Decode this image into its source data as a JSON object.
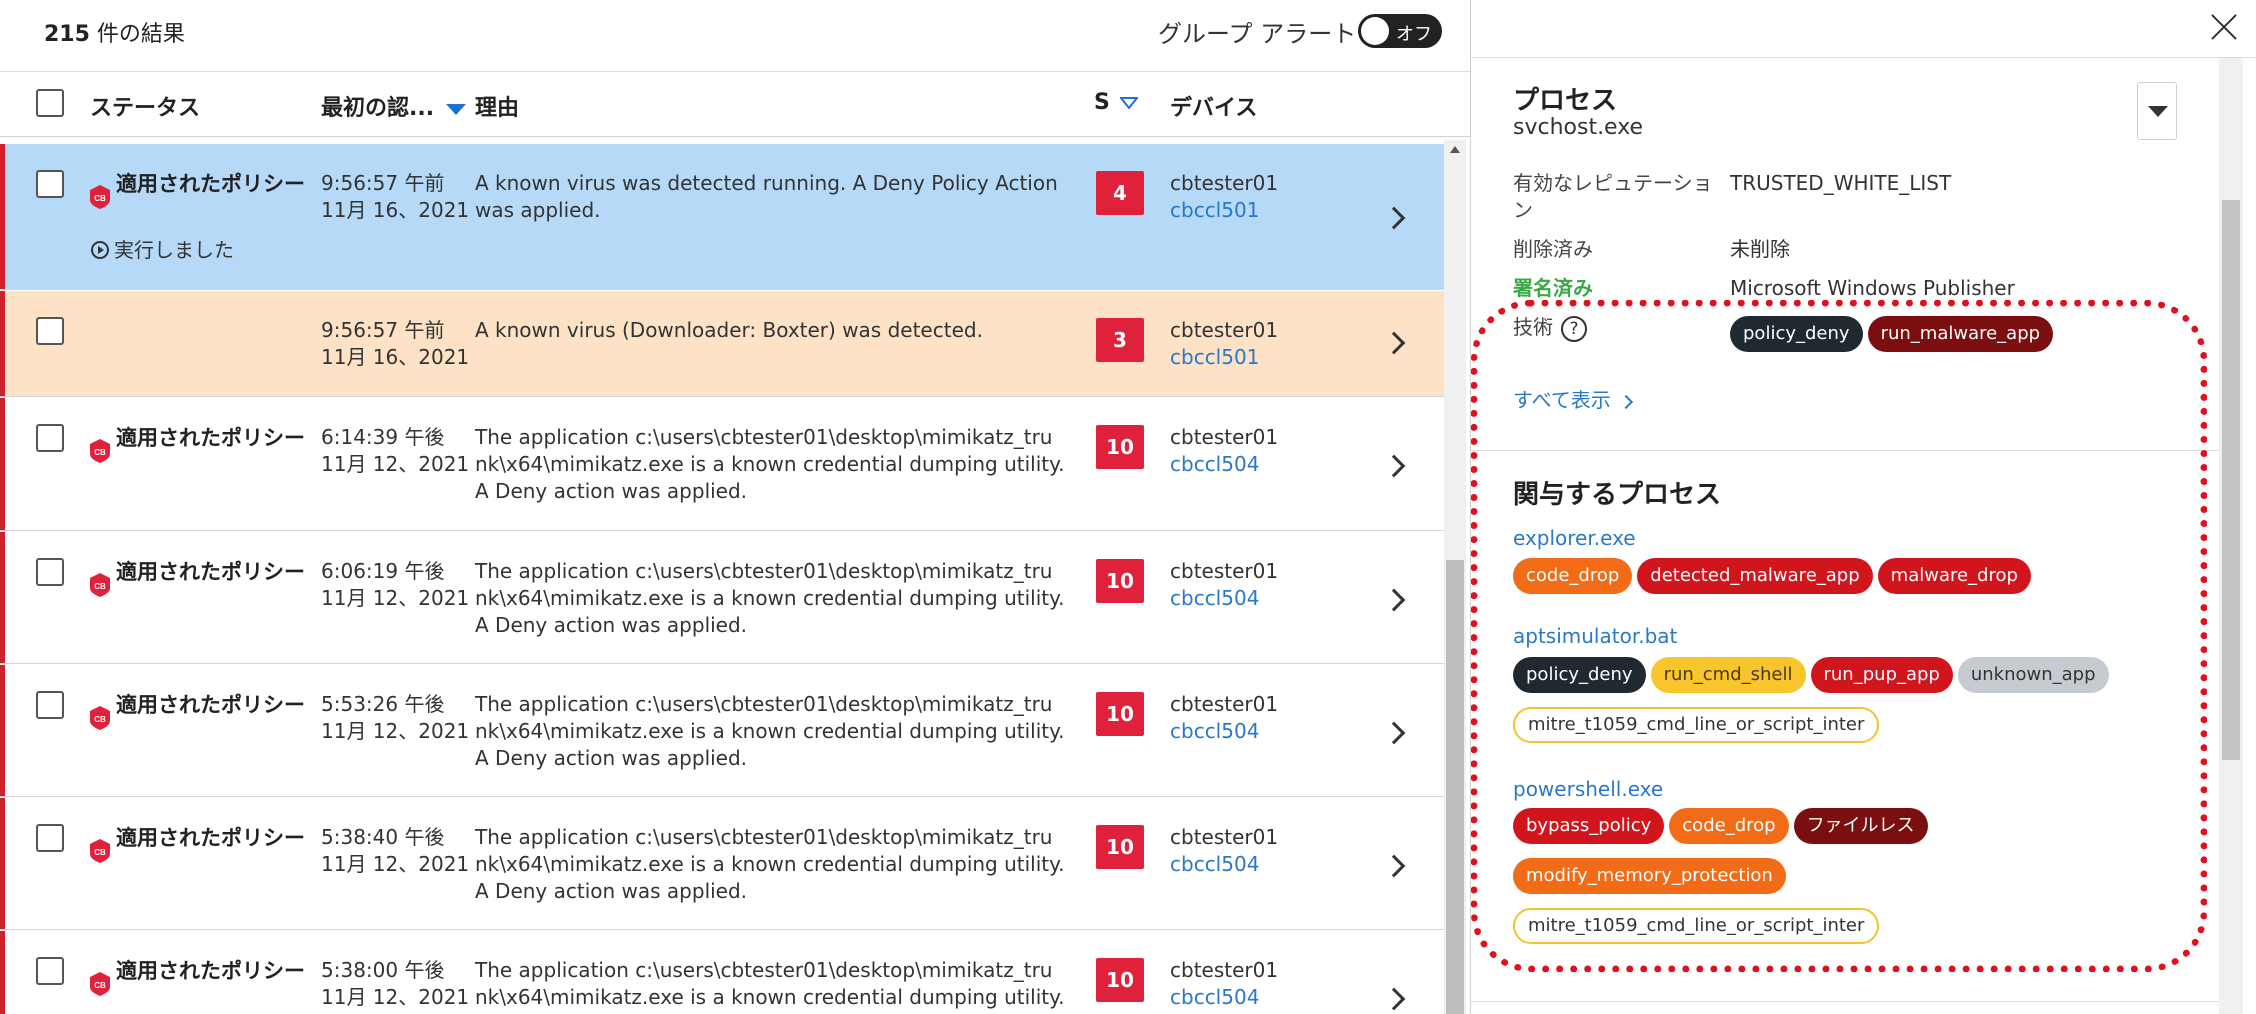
{
  "header": {
    "results_count": "215",
    "results_suffix": " 件の結果",
    "group_alert_label": "グループ アラート",
    "toggle_label": "オフ"
  },
  "table": {
    "columns": {
      "status": "ステータス",
      "first_seen": "最初の認...",
      "reason": "理由",
      "severity": "S",
      "device": "デバイス"
    },
    "rows": [
      {
        "status": "適用されたポリシー",
        "executed": "実行しました",
        "time": "9:56:57 午前",
        "date": "11月 16、2021",
        "reason": "A known virus was detected running. A Deny Policy Action was applied.",
        "severity": "4",
        "device": "cbtester01",
        "device_link": "cbccl501"
      },
      {
        "status": "",
        "executed": "",
        "time": "9:56:57 午前",
        "date": "11月 16、2021",
        "reason": "A known virus (Downloader: Boxter) was detected.",
        "severity": "3",
        "device": "cbtester01",
        "device_link": "cbccl501"
      },
      {
        "status": "適用されたポリシー",
        "executed": "",
        "time": "6:14:39 午後",
        "date": "11月 12、2021",
        "reason": "The application c:\\users\\cbtester01\\desktop\\mimikatz_trunk\\x64\\mimikatz.exe is a known credential dumping utility. A Deny action was applied.",
        "severity": "10",
        "device": "cbtester01",
        "device_link": "cbccl504"
      },
      {
        "status": "適用されたポリシー",
        "executed": "",
        "time": "6:06:19 午後",
        "date": "11月 12、2021",
        "reason": "The application c:\\users\\cbtester01\\desktop\\mimikatz_trunk\\x64\\mimikatz.exe is a known credential dumping utility. A Deny action was applied.",
        "severity": "10",
        "device": "cbtester01",
        "device_link": "cbccl504"
      },
      {
        "status": "適用されたポリシー",
        "executed": "",
        "time": "5:53:26 午後",
        "date": "11月 12、2021",
        "reason": "The application c:\\users\\cbtester01\\desktop\\mimikatz_trunk\\x64\\mimikatz.exe is a known credential dumping utility. A Deny action was applied.",
        "severity": "10",
        "device": "cbtester01",
        "device_link": "cbccl504"
      },
      {
        "status": "適用されたポリシー",
        "executed": "",
        "time": "5:38:40 午後",
        "date": "11月 12、2021",
        "reason": "The application c:\\users\\cbtester01\\desktop\\mimikatz_trunk\\x64\\mimikatz.exe is a known credential dumping utility. A Deny action was applied.",
        "severity": "10",
        "device": "cbtester01",
        "device_link": "cbccl504"
      },
      {
        "status": "適用されたポリシー",
        "executed": "",
        "time": "5:38:00 午後",
        "date": "11月 12、2021",
        "reason": "The application c:\\users\\cbtester01\\desktop\\mimikatz_trunk\\x64\\mimikatz.exe is a known credential dumping utility. A Te",
        "severity": "10",
        "device": "cbtester01",
        "device_link": "cbccl504"
      }
    ]
  },
  "panel": {
    "process_title": "プロセス",
    "process_name": "svchost.exe",
    "reputation_key": "有効なレピュテーション",
    "reputation_value": "TRUSTED_WHITE_LIST",
    "deleted_key": "削除済み",
    "deleted_value": "未削除",
    "signed_key": "署名済み",
    "signed_value": "Microsoft Windows Publisher",
    "tech_key": "技術",
    "tech_tags": [
      "policy_deny",
      "run_malware_app"
    ],
    "show_all": "すべて表示",
    "involved_title": "関与するプロセス",
    "processes": [
      {
        "name": "explorer.exe",
        "tags": [
          "code_drop",
          "detected_malware_app",
          "malware_drop"
        ]
      },
      {
        "name": "aptsimulator.bat",
        "tags": [
          "policy_deny",
          "run_cmd_shell",
          "run_pup_app",
          "unknown_app",
          "mitre_t1059_cmd_line_or_script_inter"
        ]
      },
      {
        "name": "powershell.exe",
        "tags": [
          "bypass_policy",
          "code_drop",
          "ファイルレス",
          "modify_memory_protection",
          "mitre_t1059_cmd_line_or_script_inter"
        ]
      }
    ]
  },
  "colors": {
    "selected_row": "#b5d9f7",
    "warn_row": "#fde2c6",
    "severity": "#e0213b",
    "link": "#2a78c9",
    "highlight_dotted": "#e0101e"
  }
}
